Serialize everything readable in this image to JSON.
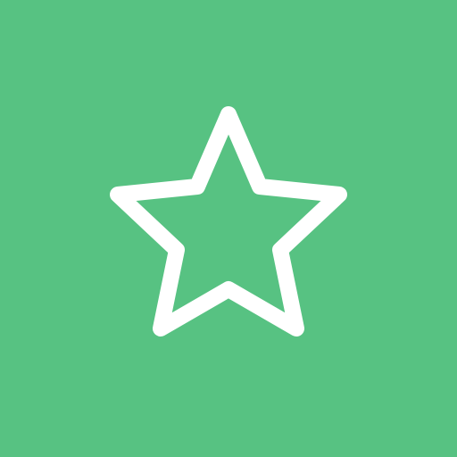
{
  "tile": {
    "background_color": "#57C282"
  },
  "icon": {
    "name": "star-outline-icon",
    "stroke_color": "#FFFFFF"
  }
}
